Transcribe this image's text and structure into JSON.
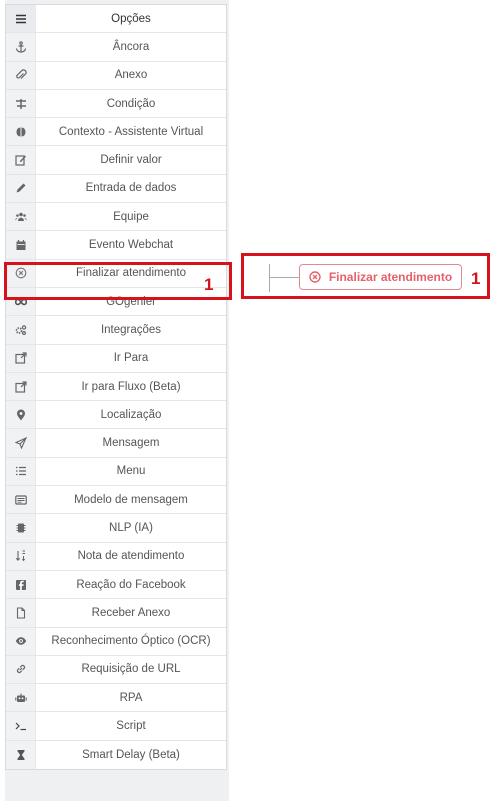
{
  "panel": {
    "header": {
      "label": "Opções",
      "icon": "menu-icon"
    },
    "items": [
      {
        "label": "Âncora",
        "icon": "anchor-icon"
      },
      {
        "label": "Anexo",
        "icon": "paperclip-icon"
      },
      {
        "label": "Condição",
        "icon": "signpost-icon"
      },
      {
        "label": "Contexto - Assistente Virtual",
        "icon": "brain-icon"
      },
      {
        "label": "Definir valor",
        "icon": "edit-icon"
      },
      {
        "label": "Entrada de dados",
        "icon": "pencil-icon"
      },
      {
        "label": "Equipe",
        "icon": "users-icon"
      },
      {
        "label": "Evento Webchat",
        "icon": "calendar-icon"
      },
      {
        "label": "Finalizar atendimento",
        "icon": "close-circle-icon"
      },
      {
        "label": "GOgenier",
        "icon": "infinity-icon"
      },
      {
        "label": "Integrações",
        "icon": "gears-icon"
      },
      {
        "label": "Ir Para",
        "icon": "external-link-icon"
      },
      {
        "label": "Ir para Fluxo (Beta)",
        "icon": "external-link-icon"
      },
      {
        "label": "Localização",
        "icon": "map-pin-icon"
      },
      {
        "label": "Mensagem",
        "icon": "send-icon"
      },
      {
        "label": "Menu",
        "icon": "list-icon"
      },
      {
        "label": "Modelo de mensagem",
        "icon": "template-icon"
      },
      {
        "label": "NLP (IA)",
        "icon": "chip-icon"
      },
      {
        "label": "Nota de atendimento",
        "icon": "sort-icon"
      },
      {
        "label": "Reação do Facebook",
        "icon": "facebook-icon"
      },
      {
        "label": "Receber Anexo",
        "icon": "file-icon"
      },
      {
        "label": "Reconhecimento Óptico (OCR)",
        "icon": "eye-icon"
      },
      {
        "label": "Requisição de URL",
        "icon": "link-icon"
      },
      {
        "label": "RPA",
        "icon": "robot-icon"
      },
      {
        "label": "Script",
        "icon": "terminal-icon"
      },
      {
        "label": "Smart Delay (Beta)",
        "icon": "hourglass-icon"
      }
    ]
  },
  "annotations": {
    "left_marker": "1",
    "right_marker": "1"
  },
  "canvas": {
    "node_label": "Finalizar atendimento",
    "node_icon": "close-circle-icon"
  },
  "colors": {
    "highlight": "#d8121b",
    "node_text": "#e5626b",
    "node_border": "#e28a8f"
  }
}
